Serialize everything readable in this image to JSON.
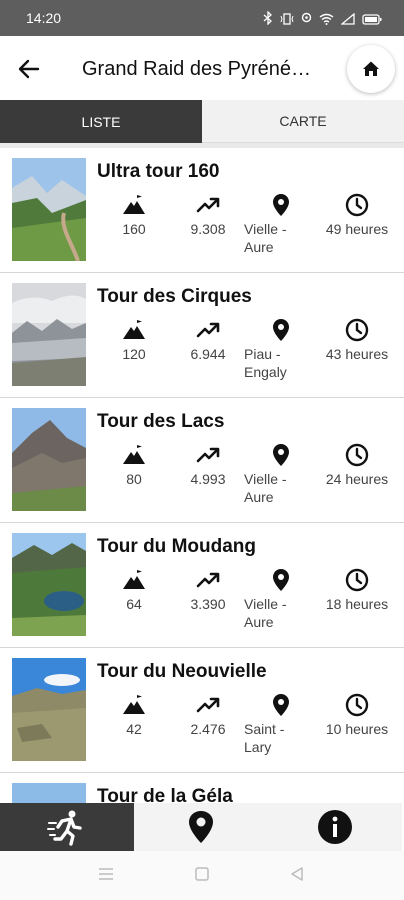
{
  "status_bar": {
    "time": "14:20"
  },
  "header": {
    "title": "Grand Raid des Pyréné…",
    "back_icon": "arrow-left-icon",
    "home_icon": "home-icon"
  },
  "tabs": [
    {
      "label": "LISTE",
      "active": true
    },
    {
      "label": "CARTE",
      "active": false
    }
  ],
  "races": [
    {
      "name": "Ultra tour 160",
      "distance": "160",
      "elevation": "9.308",
      "start": "Vielle - Aure",
      "duration": "49 heures"
    },
    {
      "name": "Tour des Cirques",
      "distance": "120",
      "elevation": "6.944",
      "start": "Piau - Engaly",
      "duration": "43 heures"
    },
    {
      "name": "Tour des Lacs",
      "distance": "80",
      "elevation": "4.993",
      "start": "Vielle - Aure",
      "duration": "24 heures"
    },
    {
      "name": "Tour du Moudang",
      "distance": "64",
      "elevation": "3.390",
      "start": "Vielle - Aure",
      "duration": "18 heures"
    },
    {
      "name": "Tour du Neouvielle",
      "distance": "42",
      "elevation": "2.476",
      "start": "Saint - Lary",
      "duration": "10 heures"
    },
    {
      "name": "Tour de la Géla",
      "distance": "",
      "elevation": "",
      "start": "",
      "duration": ""
    }
  ],
  "bottom_nav": [
    {
      "icon": "runner-icon",
      "active": true
    },
    {
      "icon": "location-pin-icon",
      "active": false
    },
    {
      "icon": "info-icon",
      "active": false
    }
  ],
  "colors": {
    "dark": "#3a3a3a",
    "light_tab": "#f1f1f1",
    "status_bar": "#5e5e5e"
  }
}
